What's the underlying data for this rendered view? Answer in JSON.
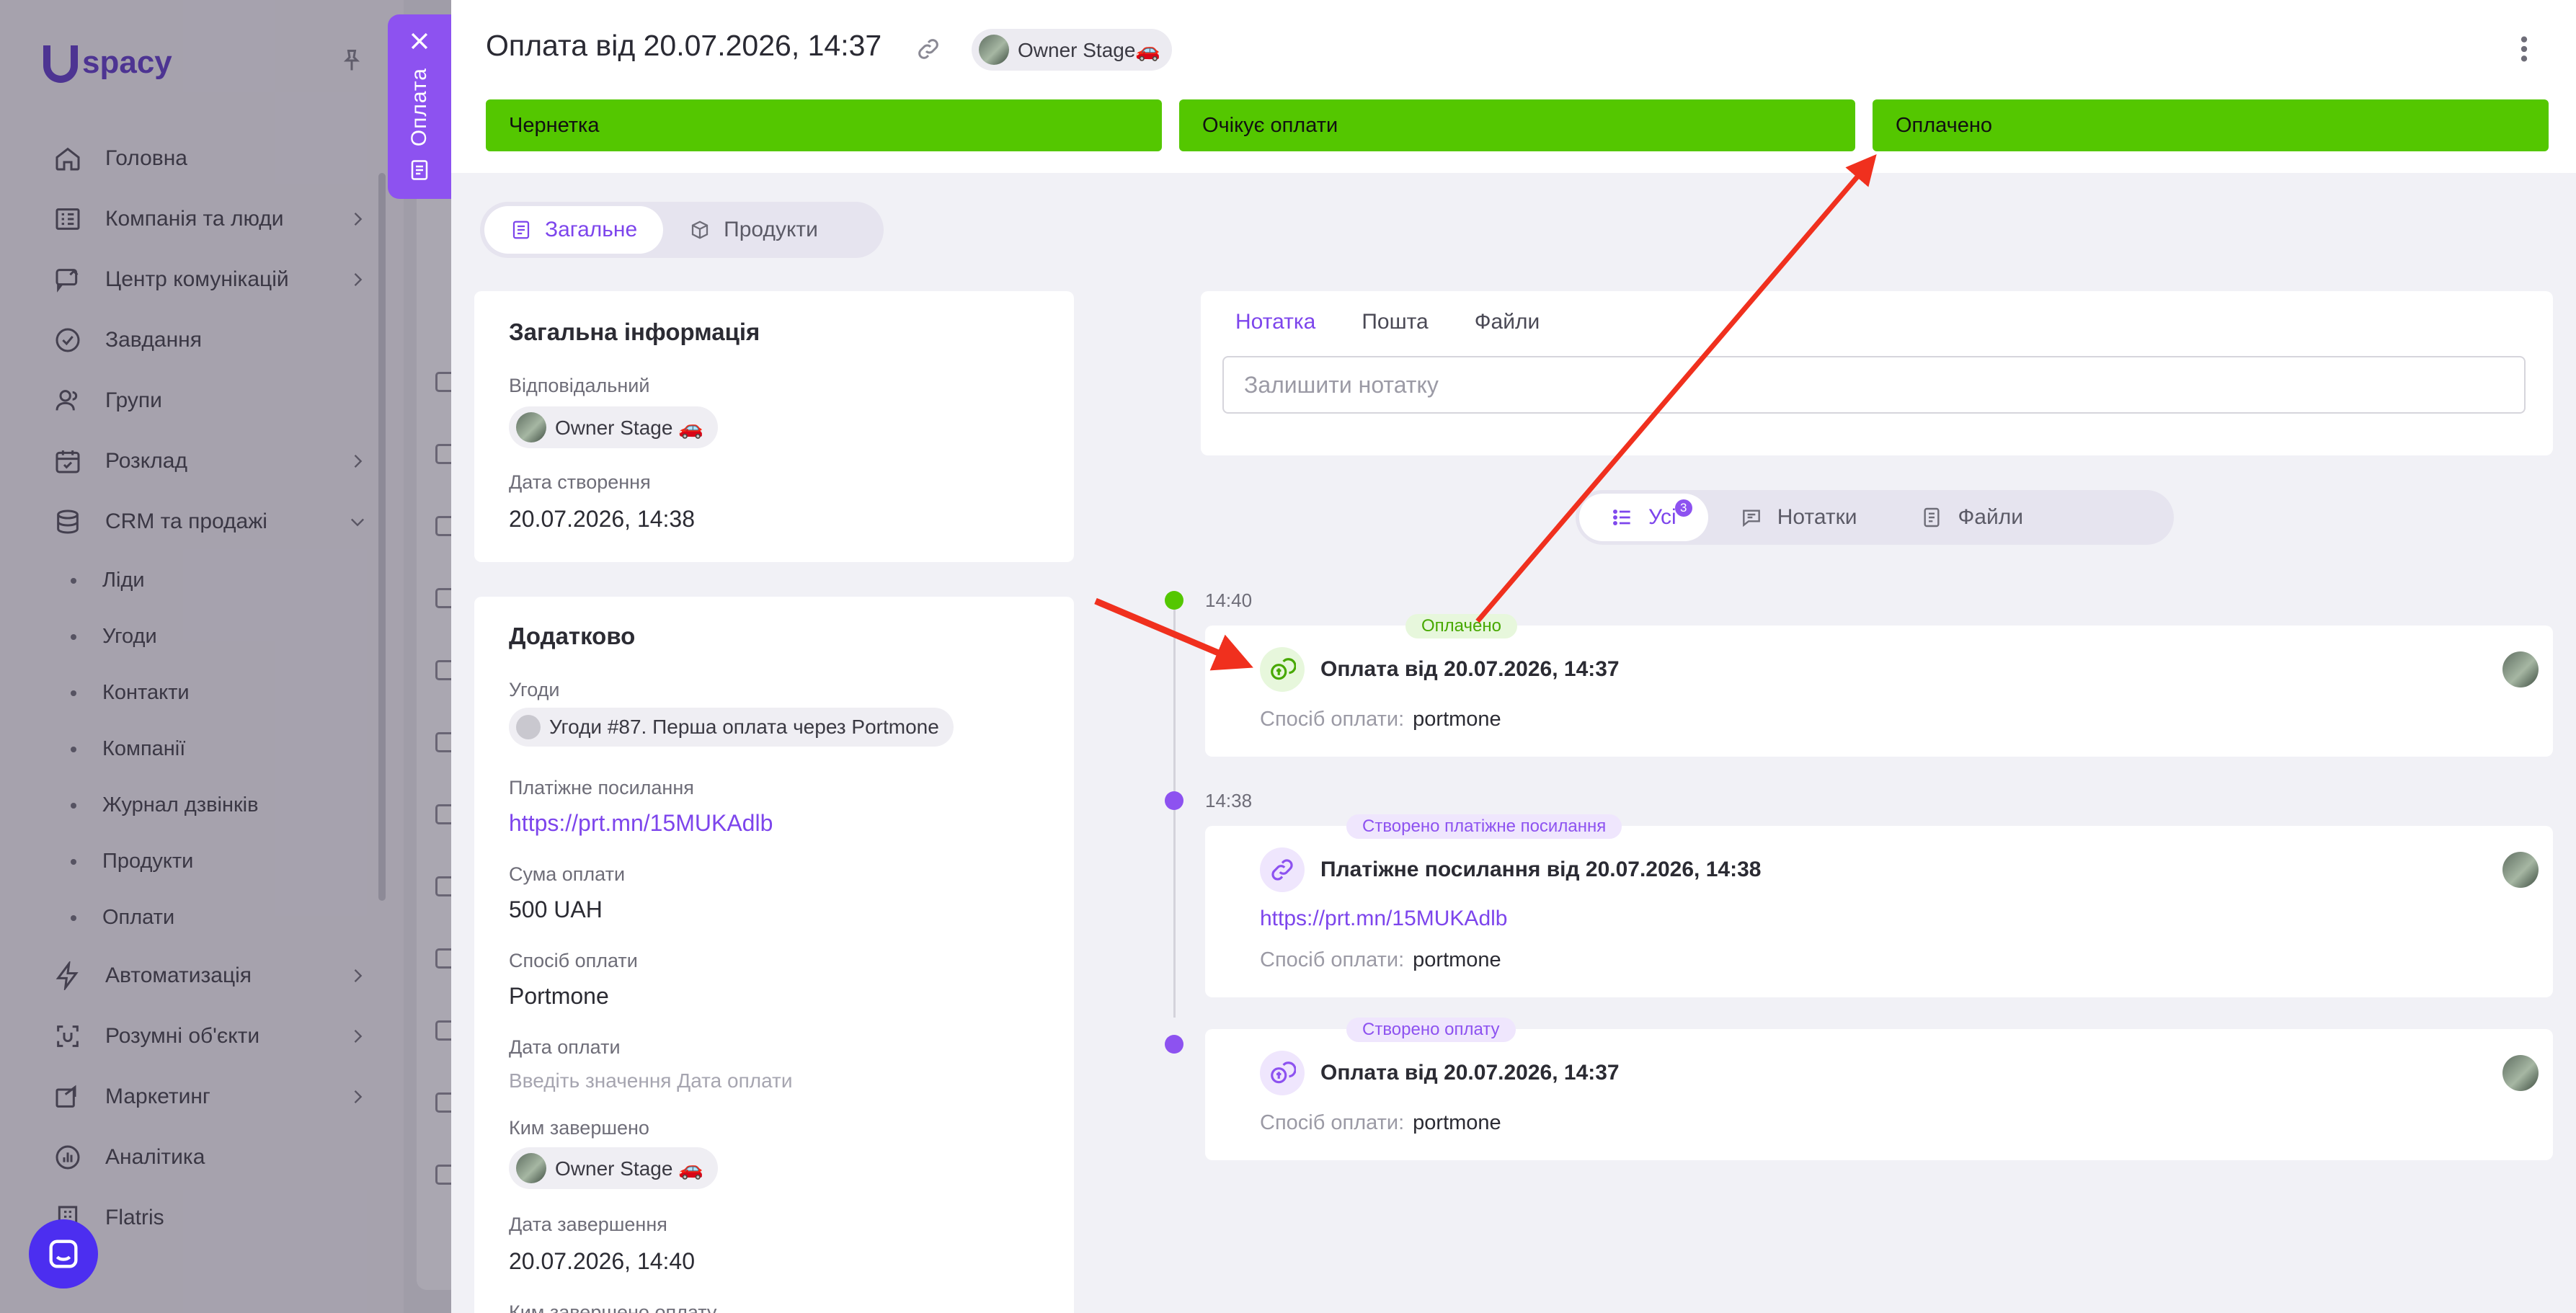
{
  "sidebar": {
    "logo": "spacy",
    "menu": [
      {
        "label": "Головна",
        "icon": "home-icon"
      },
      {
        "label": "Компанія та люди",
        "icon": "company-icon"
      },
      {
        "label": "Центр комунікацій",
        "icon": "chat-icon"
      },
      {
        "label": "Завдання",
        "icon": "check-circle-icon"
      },
      {
        "label": "Групи",
        "icon": "group-icon"
      },
      {
        "label": "Розклад",
        "icon": "calendar-icon"
      },
      {
        "label": "CRM та продажі",
        "icon": "database-icon"
      }
    ],
    "crm_sub": [
      "Ліди",
      "Угоди",
      "Контакти",
      "Компанії",
      "Журнал дзвінків",
      "Продукти",
      "Оплати"
    ],
    "menu_bottom": [
      {
        "label": "Автоматизація",
        "icon": "lightning-icon"
      },
      {
        "label": "Розумні об'єкти",
        "icon": "smart-object-icon"
      },
      {
        "label": "Маркетинг",
        "icon": "marketing-icon"
      },
      {
        "label": "Аналітика",
        "icon": "analytics-icon"
      },
      {
        "label": "Flatris",
        "icon": "building-icon"
      }
    ]
  },
  "side_tab": {
    "label": "Оплата"
  },
  "header": {
    "title": "Оплата від 20.07.2026, 14:37",
    "owner": "Owner Stage🚗"
  },
  "stages": [
    "Чернетка",
    "Очікує оплати",
    "Оплачено"
  ],
  "stage_color": "#54c700",
  "accent": "#7d45ec",
  "tabs": [
    "Загальне",
    "Продукти"
  ],
  "general": {
    "title": "Загальна інформація",
    "responsible_label": "Відповідальний",
    "responsible": "Owner Stage 🚗",
    "created_label": "Дата створення",
    "created": "20.07.2026, 14:38"
  },
  "additional": {
    "title": "Додатково",
    "deals_label": "Угоди",
    "deal": "Угоди #87. Перша оплата через Portmone",
    "link_label": "Платіжне посилання",
    "link": "https://prt.mn/15MUKAdlb",
    "amount_label": "Сума оплати",
    "amount": "500 UAH",
    "method_label": "Спосіб оплати",
    "method": "Portmone",
    "paydate_label": "Дата оплати",
    "paydate_placeholder": "Введіть значення Дата оплати",
    "completed_by_label": "Ким завершено",
    "completed_by": "Owner Stage 🚗",
    "completed_date_label": "Дата завершення",
    "completed_date": "20.07.2026, 14:40",
    "next_label": "Ким завершено оплату"
  },
  "note": {
    "tabs": [
      "Нотатка",
      "Пошта",
      "Файли"
    ],
    "placeholder": "Залишити нотатку"
  },
  "filters": [
    {
      "label": "Усі",
      "badge": "3"
    },
    {
      "label": "Нотатки"
    },
    {
      "label": "Файли"
    }
  ],
  "timeline": [
    {
      "time": "14:40",
      "tag": "Оплачено",
      "title": "Оплата від 20.07.2026, 14:37",
      "meta_label": "Спосіб оплати:",
      "meta_value": "portmone",
      "color": "#54c700"
    },
    {
      "time": "14:38",
      "tag": "Створено платіжне посилання",
      "title": "Платіжне посилання від 20.07.2026, 14:38",
      "link": "https://prt.mn/15MUKAdlb",
      "meta_label": "Спосіб оплати:",
      "meta_value": "portmone",
      "color": "#8d52f0"
    },
    {
      "tag": "Створено оплату",
      "title": "Оплата від 20.07.2026, 14:37",
      "meta_label": "Спосіб оплати:",
      "meta_value": "portmone",
      "color": "#8d52f0"
    }
  ]
}
